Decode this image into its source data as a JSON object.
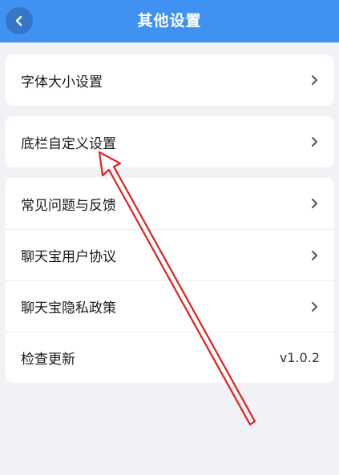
{
  "header": {
    "title": "其他设置",
    "background": "#3f92f2",
    "back_icon": "chevron-left-icon"
  },
  "group1": {
    "items": [
      {
        "label": "字体大小设置",
        "icon": "chevron-right-icon"
      }
    ]
  },
  "group2": {
    "items": [
      {
        "label": "底栏自定义设置",
        "icon": "chevron-right-icon"
      }
    ]
  },
  "group3": {
    "items": [
      {
        "label": "常见问题与反馈",
        "icon": "chevron-right-icon"
      },
      {
        "label": "聊天宝用户协议",
        "icon": "chevron-right-icon"
      },
      {
        "label": "聊天宝隐私政策",
        "icon": "chevron-right-icon"
      },
      {
        "label": "检查更新",
        "value": "v1.0.2"
      }
    ]
  },
  "annotation": {
    "color": "#e02020",
    "icon": "red-arrow-annotation"
  }
}
